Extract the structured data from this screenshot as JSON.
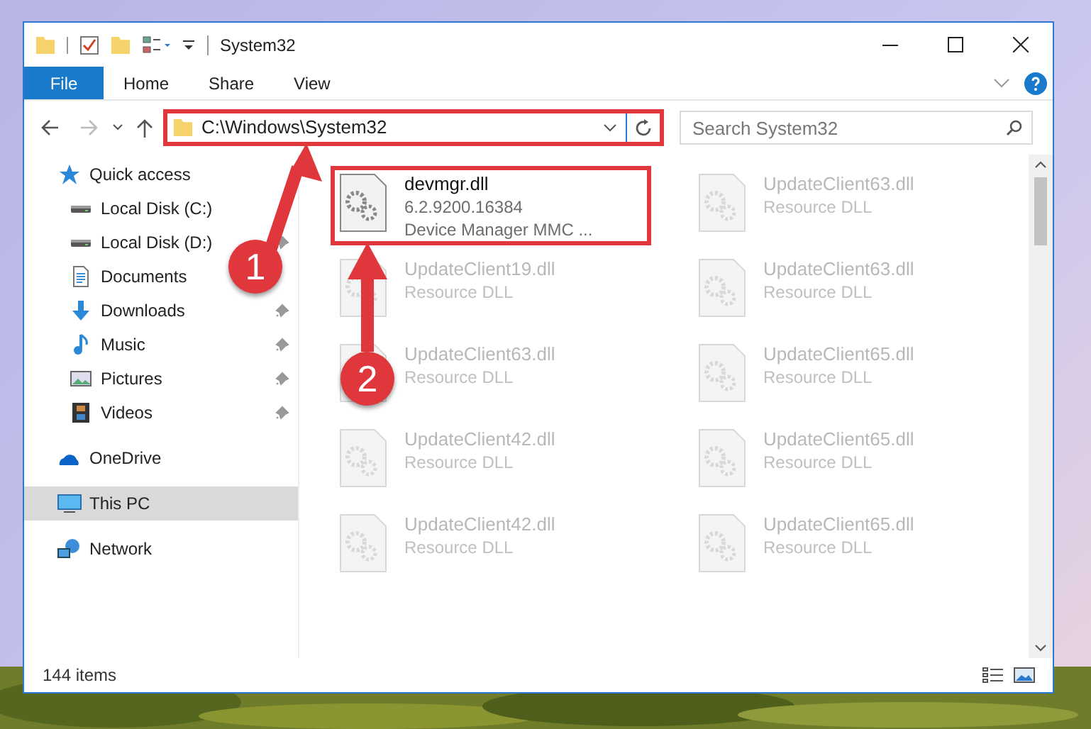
{
  "window": {
    "title": "System32"
  },
  "ribbon_tabs": [
    {
      "label": "File",
      "selected": true
    },
    {
      "label": "Home",
      "selected": false
    },
    {
      "label": "Share",
      "selected": false
    },
    {
      "label": "View",
      "selected": false
    }
  ],
  "address_bar": {
    "value": "C:\\Windows\\System32",
    "highlighted": true
  },
  "search": {
    "placeholder": "Search System32"
  },
  "sidebar": {
    "items": [
      {
        "label": "Quick access",
        "kind": "star",
        "selected": false,
        "children": [
          {
            "label": "Local Disk (C:)",
            "kind": "drive",
            "selected": false,
            "pinned": false
          },
          {
            "label": "Local Disk (D:)",
            "kind": "drive",
            "selected": false,
            "pinned": true
          },
          {
            "label": "Documents",
            "kind": "document",
            "selected": false,
            "pinned": false
          },
          {
            "label": "Downloads",
            "kind": "download",
            "selected": false,
            "pinned": true
          },
          {
            "label": "Music",
            "kind": "music",
            "selected": false,
            "pinned": true
          },
          {
            "label": "Pictures",
            "kind": "pictures",
            "selected": false,
            "pinned": true
          },
          {
            "label": "Videos",
            "kind": "videos",
            "selected": false,
            "pinned": true
          }
        ]
      },
      {
        "label": "OneDrive",
        "kind": "cloud",
        "selected": false
      },
      {
        "label": "This PC",
        "kind": "pc",
        "selected": true
      },
      {
        "label": "Network",
        "kind": "network",
        "selected": false
      }
    ]
  },
  "files": [
    {
      "name": "devmgr.dll",
      "lines": [
        "6.2.9200.16384",
        "Device Manager MMC ..."
      ],
      "highlighted": true,
      "blurred": false
    },
    {
      "name": "UpdateClient63.dll",
      "lines": [
        "Resource DLL"
      ],
      "highlighted": false,
      "blurred": true
    },
    {
      "name": "UpdateClient19.dll",
      "lines": [
        "Resource DLL"
      ],
      "highlighted": false,
      "blurred": true
    },
    {
      "name": "UpdateClient63.dll",
      "lines": [
        "Resource DLL"
      ],
      "highlighted": false,
      "blurred": true
    },
    {
      "name": "UpdateClient63.dll",
      "lines": [
        "Resource DLL"
      ],
      "highlighted": false,
      "blurred": true
    },
    {
      "name": "UpdateClient65.dll",
      "lines": [
        "Resource DLL"
      ],
      "highlighted": false,
      "blurred": true
    },
    {
      "name": "UpdateClient42.dll",
      "lines": [
        "Resource DLL"
      ],
      "highlighted": false,
      "blurred": true
    },
    {
      "name": "UpdateClient65.dll",
      "lines": [
        "Resource DLL"
      ],
      "highlighted": false,
      "blurred": true
    },
    {
      "name": "UpdateClient42.dll",
      "lines": [
        "Resource DLL"
      ],
      "highlighted": false,
      "blurred": true
    },
    {
      "name": "UpdateClient65.dll",
      "lines": [
        "Resource DLL"
      ],
      "highlighted": false,
      "blurred": true
    }
  ],
  "status_bar": {
    "item_count": "144 items"
  },
  "annotations": [
    {
      "label": "1"
    },
    {
      "label": "2"
    }
  ]
}
